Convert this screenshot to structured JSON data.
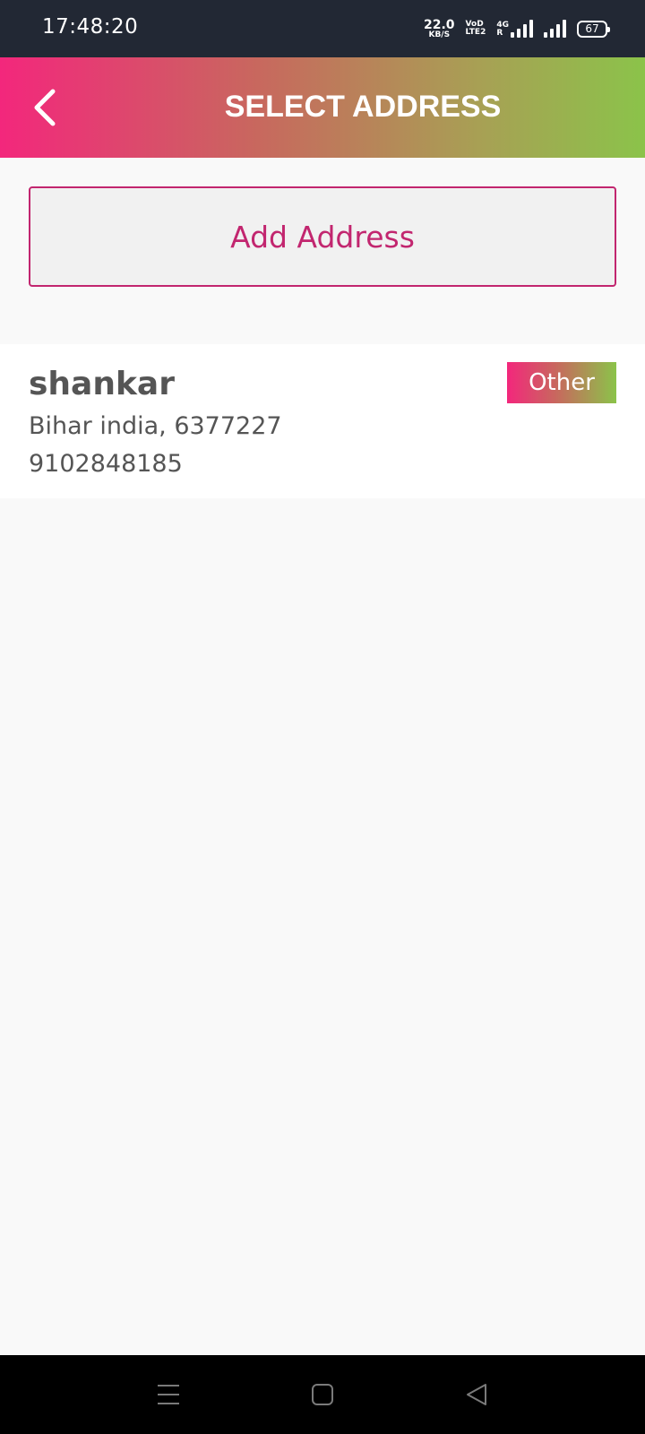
{
  "status_bar": {
    "time": "17:48:20",
    "net_speed_value": "22.0",
    "net_speed_unit": "KB/S",
    "volte_top": "VoD",
    "volte_bottom": "LTE2",
    "network_top": "4G",
    "network_bottom": "R",
    "battery_level": "67"
  },
  "header": {
    "title": "SELECT ADDRESS",
    "back_icon": "chevron-left-icon"
  },
  "add_address": {
    "label": "Add Address"
  },
  "addresses": [
    {
      "name": "shankar",
      "address_line": "Bihar india, 6377227",
      "phone": "9102848185",
      "tag": "Other"
    }
  ],
  "nav_bar": {
    "icons": [
      "menu-icon",
      "home-square-icon",
      "back-triangle-icon"
    ]
  },
  "colors": {
    "accent": "#c2266f",
    "gradient_start": "#f3277c",
    "gradient_end": "#8bc34a",
    "status_bar_bg": "#222834"
  }
}
